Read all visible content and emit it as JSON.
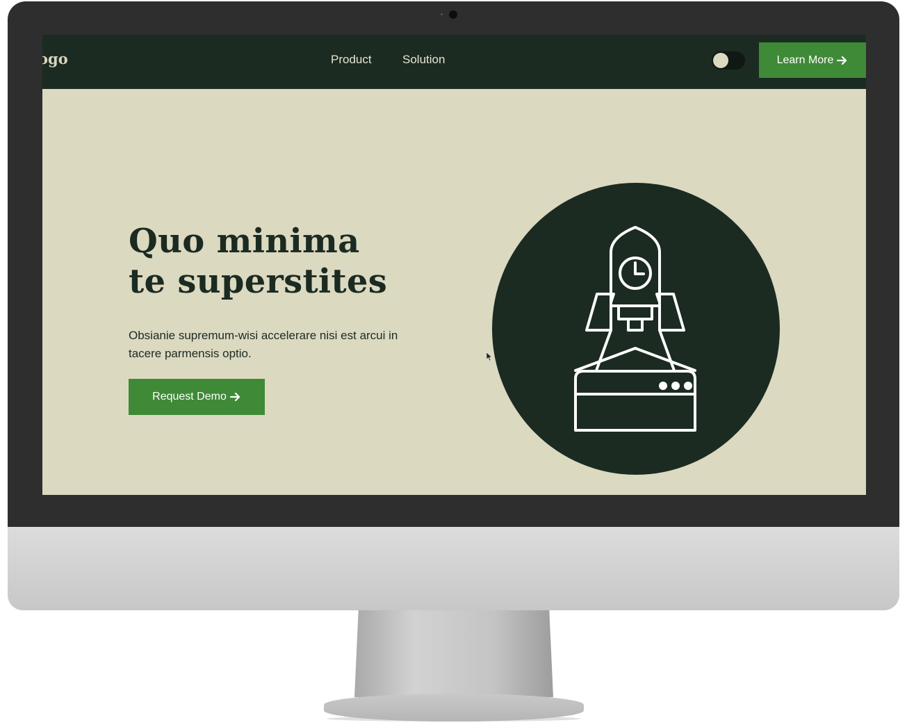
{
  "nav": {
    "logo": "ogo",
    "links": [
      "Product",
      "Solution"
    ],
    "theme_toggle": "off",
    "cta_label": "Learn More",
    "cta_icon": "arrow-right-icon"
  },
  "hero": {
    "title_line1": "Quo minima",
    "title_line2": "te superstites",
    "subtitle": "Obsianie supremum-wisi accelerare nisi est arcui in tacere parmensis optio.",
    "button_label": "Request Demo",
    "button_icon": "arrow-right-icon",
    "illustration": "rocket-launch-icon"
  },
  "colors": {
    "navbar": "#1b2b22",
    "background": "#dcd9c1",
    "accent": "#3f8a37",
    "text": "#1b2b22"
  }
}
